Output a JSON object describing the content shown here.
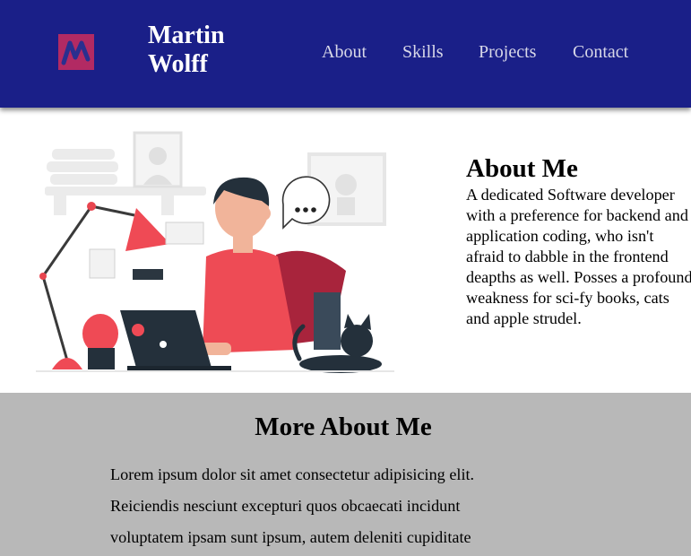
{
  "header": {
    "brand_name": "Martin Wolff",
    "logo_icon": "m-monogram-icon",
    "nav": [
      {
        "label": "About"
      },
      {
        "label": "Skills"
      },
      {
        "label": "Projects"
      },
      {
        "label": "Contact"
      }
    ],
    "background_color": "#1a1f88"
  },
  "about": {
    "title": "About Me",
    "text": "A dedicated Software developer with a preference for backend and application coding, who isn't afraid to dabble in the frontend deapths as well. Posses a profound weakness for sci-fy books, cats and apple strudel.",
    "illustration": "developer-at-desk-illustration"
  },
  "more_about": {
    "title": "More About Me",
    "text": "Lorem ipsum dolor sit amet consectetur adipisicing elit. Reiciendis nesciunt excepturi quos obcaecati incidunt voluptatem ipsam sunt ipsum, autem deleniti cupiditate",
    "background_color": "#b8b8b8"
  }
}
